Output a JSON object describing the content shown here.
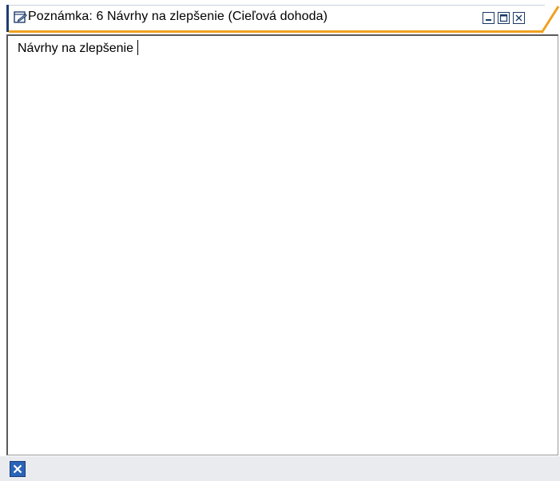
{
  "window": {
    "title": "Poznámka: 6 Návrhy na zlepšenie  (Cieľová dohoda)",
    "title_icon": "edit-note-icon",
    "buttons": {
      "minimize_icon": "minimize-icon",
      "maximize_icon": "maximize-icon",
      "close_icon": "close-icon"
    }
  },
  "editor": {
    "text": "Návrhy na zlepšenie"
  },
  "bottombar": {
    "close_icon": "close-icon"
  },
  "colors": {
    "title_accent": "#f0a020",
    "frame_dark": "#1f3d6e",
    "bottom_close_bg": "#2a63b8",
    "bottombar_bg": "#e9ebef"
  }
}
